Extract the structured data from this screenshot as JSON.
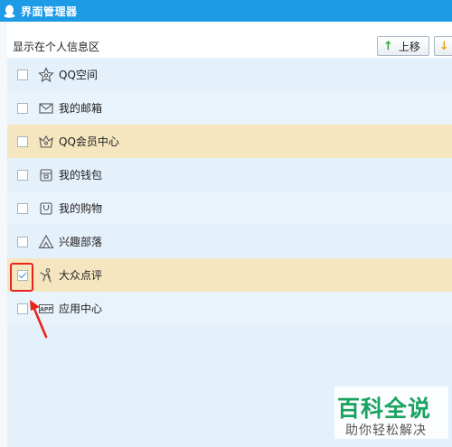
{
  "window": {
    "title": "界面管理器"
  },
  "section": {
    "label": "显示在个人信息区"
  },
  "toolbar": {
    "move_up_label": "上移",
    "move_down_label": ""
  },
  "items": [
    {
      "label": "QQ空间",
      "icon": "star-icon",
      "checked": false
    },
    {
      "label": "我的邮箱",
      "icon": "mail-icon",
      "checked": false
    },
    {
      "label": "QQ会员中心",
      "icon": "vip-crown-icon",
      "checked": false
    },
    {
      "label": "我的钱包",
      "icon": "wallet-icon",
      "checked": false
    },
    {
      "label": "我的购物",
      "icon": "shopping-bag-icon",
      "checked": false
    },
    {
      "label": "兴趣部落",
      "icon": "tribe-icon",
      "checked": false
    },
    {
      "label": "大众点评",
      "icon": "dianping-icon",
      "checked": true
    },
    {
      "label": "应用中心",
      "icon": "app-icon",
      "checked": false
    }
  ],
  "watermark": {
    "title": "百科全说",
    "subtitle": "助你轻松解决"
  },
  "colors": {
    "titlebar": "#1d9be6",
    "highlight": "#f5e6bf",
    "annotation": "#e8241c",
    "watermark": "#1aa260"
  }
}
